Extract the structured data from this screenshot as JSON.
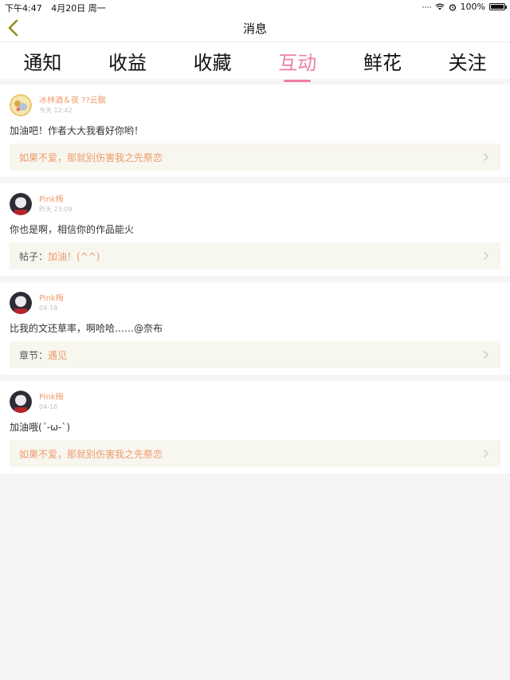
{
  "status_bar": {
    "time": "下午4:47",
    "date": "4月20日 周一",
    "battery": "100%"
  },
  "nav": {
    "title": "消息"
  },
  "tabs": [
    {
      "label": "通知"
    },
    {
      "label": "收益"
    },
    {
      "label": "收藏"
    },
    {
      "label": "互动"
    },
    {
      "label": "鲜花"
    },
    {
      "label": "关注"
    }
  ],
  "active_tab": "互动",
  "colors": {
    "accent_pink": "#ee7fab",
    "username_orange": "#ef9b6c",
    "ref_bg": "#f7f6ef"
  },
  "feed": [
    {
      "username": "冰林酒＆夜 ??云飘",
      "time": "今天 12:42",
      "content": "加油吧！作者大大我看好你哟！",
      "ref_label": "",
      "ref_value": "如果不爱，那就别伤害我之先祭恋"
    },
    {
      "username": "Pink梅",
      "time": "昨天 23:09",
      "content": "你也是啊，相信你的作品能火",
      "ref_label": "帖子：",
      "ref_value": "加油！(^^)"
    },
    {
      "username": "Pink梅",
      "time": "04-18",
      "content": "比我的文还草率，啊哈哈……@奈布",
      "ref_label": "章节：",
      "ref_value": "遇见"
    },
    {
      "username": "Pink梅",
      "time": "04-18",
      "content": "加油哦(´-ω-`)",
      "ref_label": "",
      "ref_value": "如果不爱，那就别伤害我之先祭恋"
    }
  ]
}
